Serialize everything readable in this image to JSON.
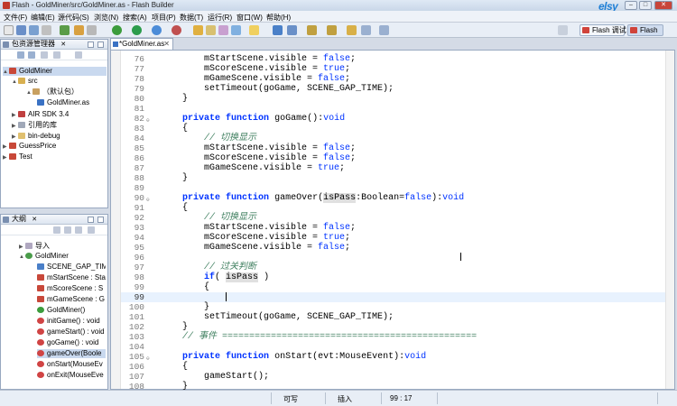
{
  "window": {
    "title": "Flash - GoldMiner/src/GoldMiner.as - Flash Builder",
    "logo": "elsy",
    "minimize": "–",
    "maximize": "□",
    "close": "✕"
  },
  "menu": [
    "文件(F)",
    "编辑(E)",
    "源代码(S)",
    "浏览(N)",
    "搜索(A)",
    "项目(P)",
    "数据(T)",
    "运行(R)",
    "窗口(W)",
    "帮助(H)"
  ],
  "perspectives": {
    "debug": "Flash 调试",
    "flash": "Flash"
  },
  "package_explorer": {
    "title": "包资源管理器",
    "close": "✕",
    "items": [
      "GoldMiner",
      "src",
      "（默认包）",
      "GoldMiner.as",
      "AIR SDK 3.4",
      "引用的库",
      "bin-debug",
      "GuessPrice",
      "Test"
    ]
  },
  "outline": {
    "title": "大纲",
    "close": "✕",
    "items": [
      "导入",
      "GoldMiner",
      "SCENE_GAP_TIM",
      "mStartScene : Sta",
      "mScoreScene : S",
      "mGameScene : G",
      "GoldMiner()",
      "initGame() : void",
      "gameStart() : void",
      "goGame() : void",
      "gameOver(Boole",
      "onStart(MouseEv",
      "onExit(MouseEve"
    ]
  },
  "editor": {
    "tab": "*GoldMiner.as",
    "tab_close": "✕",
    "lines": [
      {
        "num": "76",
        "code": "        mStartScene.visible = false;"
      },
      {
        "num": "77",
        "code": "        mScoreScene.visible = true;"
      },
      {
        "num": "78",
        "code": "        mGameScene.visible = false;"
      },
      {
        "num": "79",
        "code": "        setTimeout(goGame, SCENE_GAP_TIME);"
      },
      {
        "num": "80",
        "code": "    }"
      },
      {
        "num": "81",
        "code": ""
      },
      {
        "num": "82",
        "code": "    private function goGame():void",
        "fold": "⊖"
      },
      {
        "num": "83",
        "code": "    {"
      },
      {
        "num": "84",
        "code": "        // 切换显示"
      },
      {
        "num": "85",
        "code": "        mStartScene.visible = false;"
      },
      {
        "num": "86",
        "code": "        mScoreScene.visible = false;"
      },
      {
        "num": "87",
        "code": "        mGameScene.visible = true;"
      },
      {
        "num": "88",
        "code": "    }"
      },
      {
        "num": "89",
        "code": ""
      },
      {
        "num": "90",
        "code": "    private function gameOver(isPass:Boolean=false):void",
        "fold": "⊖"
      },
      {
        "num": "91",
        "code": "    {"
      },
      {
        "num": "92",
        "code": "        // 切换显示"
      },
      {
        "num": "93",
        "code": "        mStartScene.visible = false;"
      },
      {
        "num": "94",
        "code": "        mScoreScene.visible = true;"
      },
      {
        "num": "95",
        "code": "        mGameScene.visible = false;"
      },
      {
        "num": "96",
        "code": ""
      },
      {
        "num": "97",
        "code": "        // 过关判断"
      },
      {
        "num": "98",
        "code": "        if( isPass )"
      },
      {
        "num": "99",
        "code": "        {"
      },
      {
        "num": "99",
        "code": "            "
      },
      {
        "num": "100",
        "code": "        }"
      },
      {
        "num": "101",
        "code": "        setTimeout(goGame, SCENE_GAP_TIME);"
      },
      {
        "num": "102",
        "code": "    }"
      },
      {
        "num": "103",
        "code": "    // 事件 ==============================================="
      },
      {
        "num": "104",
        "code": ""
      },
      {
        "num": "105",
        "code": "    private function onStart(evt:MouseEvent):void",
        "fold": "⊖"
      },
      {
        "num": "106",
        "code": "    {"
      },
      {
        "num": "107",
        "code": "        gameStart();"
      },
      {
        "num": "108",
        "code": "    }"
      }
    ]
  },
  "status": {
    "writable": "可写",
    "insert": "插入",
    "position": "99 : 17"
  }
}
